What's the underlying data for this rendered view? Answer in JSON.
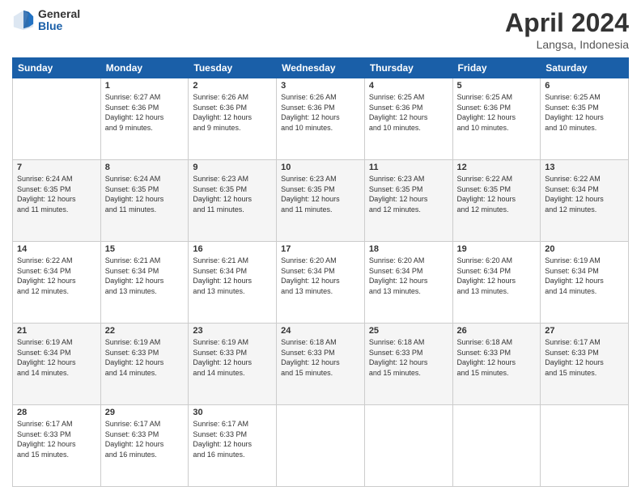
{
  "logo": {
    "general": "General",
    "blue": "Blue"
  },
  "title": "April 2024",
  "subtitle": "Langsa, Indonesia",
  "days": [
    "Sunday",
    "Monday",
    "Tuesday",
    "Wednesday",
    "Thursday",
    "Friday",
    "Saturday"
  ],
  "weeks": [
    {
      "shaded": false,
      "cells": [
        {
          "day": "",
          "info": ""
        },
        {
          "day": "1",
          "info": "Sunrise: 6:27 AM\nSunset: 6:36 PM\nDaylight: 12 hours\nand 9 minutes."
        },
        {
          "day": "2",
          "info": "Sunrise: 6:26 AM\nSunset: 6:36 PM\nDaylight: 12 hours\nand 9 minutes."
        },
        {
          "day": "3",
          "info": "Sunrise: 6:26 AM\nSunset: 6:36 PM\nDaylight: 12 hours\nand 10 minutes."
        },
        {
          "day": "4",
          "info": "Sunrise: 6:25 AM\nSunset: 6:36 PM\nDaylight: 12 hours\nand 10 minutes."
        },
        {
          "day": "5",
          "info": "Sunrise: 6:25 AM\nSunset: 6:36 PM\nDaylight: 12 hours\nand 10 minutes."
        },
        {
          "day": "6",
          "info": "Sunrise: 6:25 AM\nSunset: 6:35 PM\nDaylight: 12 hours\nand 10 minutes."
        }
      ]
    },
    {
      "shaded": true,
      "cells": [
        {
          "day": "7",
          "info": "Sunrise: 6:24 AM\nSunset: 6:35 PM\nDaylight: 12 hours\nand 11 minutes."
        },
        {
          "day": "8",
          "info": "Sunrise: 6:24 AM\nSunset: 6:35 PM\nDaylight: 12 hours\nand 11 minutes."
        },
        {
          "day": "9",
          "info": "Sunrise: 6:23 AM\nSunset: 6:35 PM\nDaylight: 12 hours\nand 11 minutes."
        },
        {
          "day": "10",
          "info": "Sunrise: 6:23 AM\nSunset: 6:35 PM\nDaylight: 12 hours\nand 11 minutes."
        },
        {
          "day": "11",
          "info": "Sunrise: 6:23 AM\nSunset: 6:35 PM\nDaylight: 12 hours\nand 12 minutes."
        },
        {
          "day": "12",
          "info": "Sunrise: 6:22 AM\nSunset: 6:35 PM\nDaylight: 12 hours\nand 12 minutes."
        },
        {
          "day": "13",
          "info": "Sunrise: 6:22 AM\nSunset: 6:34 PM\nDaylight: 12 hours\nand 12 minutes."
        }
      ]
    },
    {
      "shaded": false,
      "cells": [
        {
          "day": "14",
          "info": "Sunrise: 6:22 AM\nSunset: 6:34 PM\nDaylight: 12 hours\nand 12 minutes."
        },
        {
          "day": "15",
          "info": "Sunrise: 6:21 AM\nSunset: 6:34 PM\nDaylight: 12 hours\nand 13 minutes."
        },
        {
          "day": "16",
          "info": "Sunrise: 6:21 AM\nSunset: 6:34 PM\nDaylight: 12 hours\nand 13 minutes."
        },
        {
          "day": "17",
          "info": "Sunrise: 6:20 AM\nSunset: 6:34 PM\nDaylight: 12 hours\nand 13 minutes."
        },
        {
          "day": "18",
          "info": "Sunrise: 6:20 AM\nSunset: 6:34 PM\nDaylight: 12 hours\nand 13 minutes."
        },
        {
          "day": "19",
          "info": "Sunrise: 6:20 AM\nSunset: 6:34 PM\nDaylight: 12 hours\nand 13 minutes."
        },
        {
          "day": "20",
          "info": "Sunrise: 6:19 AM\nSunset: 6:34 PM\nDaylight: 12 hours\nand 14 minutes."
        }
      ]
    },
    {
      "shaded": true,
      "cells": [
        {
          "day": "21",
          "info": "Sunrise: 6:19 AM\nSunset: 6:34 PM\nDaylight: 12 hours\nand 14 minutes."
        },
        {
          "day": "22",
          "info": "Sunrise: 6:19 AM\nSunset: 6:33 PM\nDaylight: 12 hours\nand 14 minutes."
        },
        {
          "day": "23",
          "info": "Sunrise: 6:19 AM\nSunset: 6:33 PM\nDaylight: 12 hours\nand 14 minutes."
        },
        {
          "day": "24",
          "info": "Sunrise: 6:18 AM\nSunset: 6:33 PM\nDaylight: 12 hours\nand 15 minutes."
        },
        {
          "day": "25",
          "info": "Sunrise: 6:18 AM\nSunset: 6:33 PM\nDaylight: 12 hours\nand 15 minutes."
        },
        {
          "day": "26",
          "info": "Sunrise: 6:18 AM\nSunset: 6:33 PM\nDaylight: 12 hours\nand 15 minutes."
        },
        {
          "day": "27",
          "info": "Sunrise: 6:17 AM\nSunset: 6:33 PM\nDaylight: 12 hours\nand 15 minutes."
        }
      ]
    },
    {
      "shaded": false,
      "cells": [
        {
          "day": "28",
          "info": "Sunrise: 6:17 AM\nSunset: 6:33 PM\nDaylight: 12 hours\nand 15 minutes."
        },
        {
          "day": "29",
          "info": "Sunrise: 6:17 AM\nSunset: 6:33 PM\nDaylight: 12 hours\nand 16 minutes."
        },
        {
          "day": "30",
          "info": "Sunrise: 6:17 AM\nSunset: 6:33 PM\nDaylight: 12 hours\nand 16 minutes."
        },
        {
          "day": "",
          "info": ""
        },
        {
          "day": "",
          "info": ""
        },
        {
          "day": "",
          "info": ""
        },
        {
          "day": "",
          "info": ""
        }
      ]
    }
  ]
}
